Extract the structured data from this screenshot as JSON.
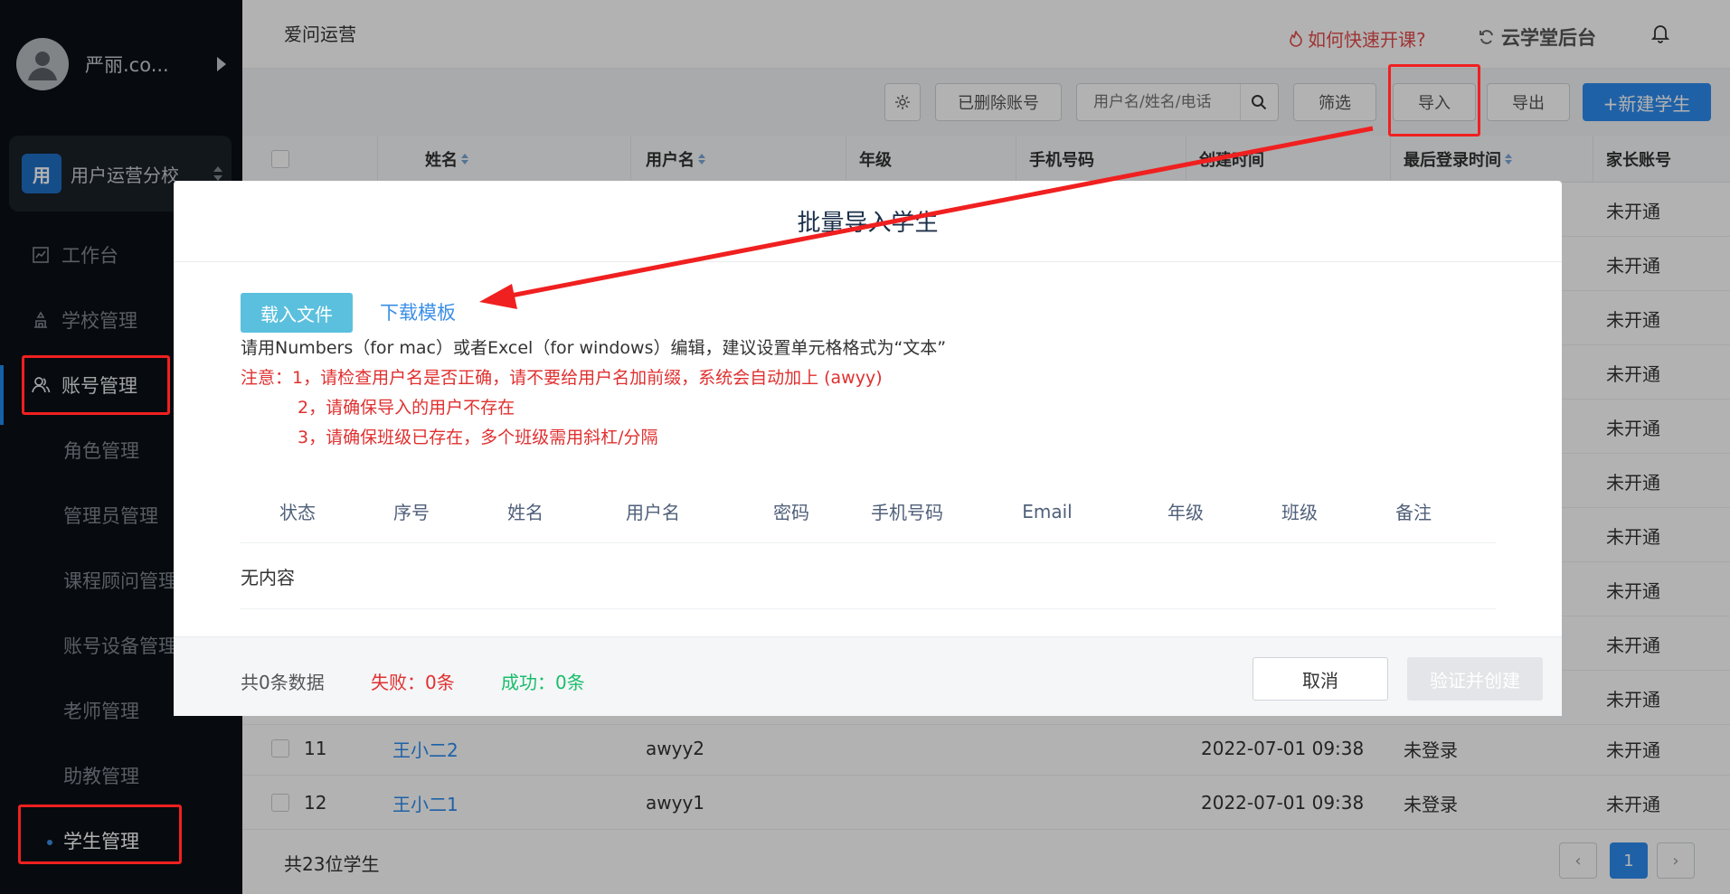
{
  "sidebar": {
    "user_name": "严丽.co...",
    "branch_badge": "用",
    "branch_name": "用户运营分校",
    "items": [
      {
        "label": "工作台"
      },
      {
        "label": "学校管理"
      },
      {
        "label": "账号管理"
      },
      {
        "label": "角色管理"
      },
      {
        "label": "管理员管理"
      },
      {
        "label": "课程顾问管理"
      },
      {
        "label": "账号设备管理"
      },
      {
        "label": "老师管理"
      },
      {
        "label": "助教管理"
      },
      {
        "label": "学生管理"
      }
    ]
  },
  "header": {
    "title": "爱问运营",
    "help_link": "如何快速开课?",
    "brand": "云学堂后台"
  },
  "toolbar": {
    "deleted_accounts": "已删除账号",
    "search_placeholder": "用户名/姓名/电话",
    "filter": "筛选",
    "import": "导入",
    "export": "导出",
    "new_student": "+新建学生"
  },
  "table": {
    "headers": [
      "姓名",
      "用户名",
      "年级",
      "手机号码",
      "创建时间",
      "最后登录时间",
      "家长账号"
    ],
    "right_col_values": [
      "未开通",
      "未开通",
      "未开通",
      "未开通",
      "未开通",
      "未开通",
      "未开通",
      "未开通",
      "未开通",
      "未开通"
    ],
    "rows": [
      {
        "index": "11",
        "name": "王小二2",
        "username": "awyy2",
        "created": "2022-07-01 09:38",
        "last_login": "未登录",
        "parent": "未开通"
      },
      {
        "index": "12",
        "name": "王小二1",
        "username": "awyy1",
        "created": "2022-07-01 09:38",
        "last_login": "未登录",
        "parent": "未开通"
      }
    ],
    "total": "共23位学生",
    "current_page": "1"
  },
  "modal": {
    "title": "批量导入学生",
    "load_file": "载入文件",
    "download_template": "下载模板",
    "tip": "请用Numbers（for mac）或者Excel（for windows）编辑，建议设置单元格格式为“文本”",
    "warnings": [
      "注意：1，请检查用户名是否正确，请不要给用户名加前缀，系统会自动加上 (awyy)",
      "2，请确保导入的用户不存在",
      "3，请确保班级已存在，多个班级需用斜杠/分隔"
    ],
    "columns": [
      "状态",
      "序号",
      "姓名",
      "用户名",
      "密码",
      "手机号码",
      "Email",
      "年级",
      "班级",
      "备注"
    ],
    "empty_text": "无内容",
    "stats": {
      "total": "共0条数据",
      "failed": "失败：0条",
      "success": "成功：0条"
    },
    "cancel": "取消",
    "verify_create": "验证并创建"
  },
  "colors": {
    "accent": "#2d8cf0",
    "danger": "#e03030",
    "success": "#19be6b",
    "sidebar_bg": "#0b1016",
    "annotation": "#f02020"
  }
}
